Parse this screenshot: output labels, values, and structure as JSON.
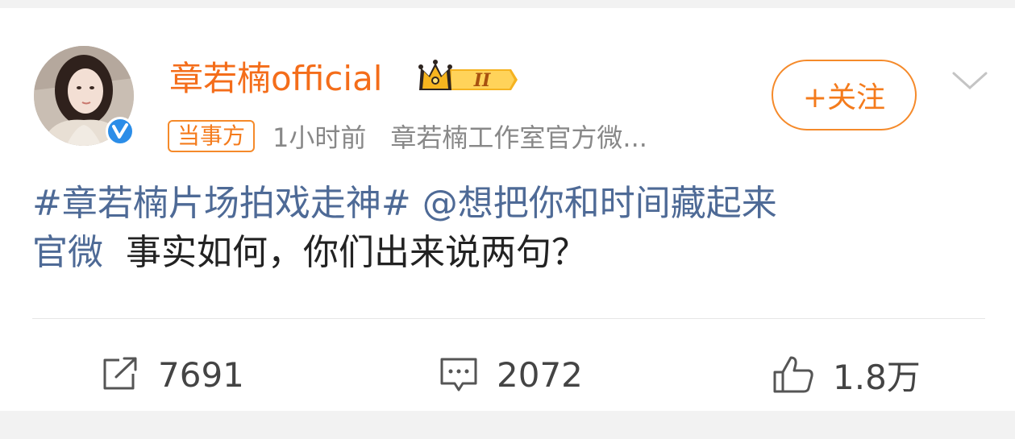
{
  "post": {
    "author": "章若楠official",
    "level_badge": "II",
    "tag": "当事方",
    "time": "1小时前",
    "source": "章若楠工作室官方微...",
    "follow_label": "+关注",
    "content": {
      "hashtag": "#章若楠片场拍戏走神#",
      "mention_line1": "@想把你和时间藏起来",
      "mention_line2": "官微",
      "text": "事实如何，你们出来说两句？"
    }
  },
  "actions": {
    "repost_count": "7691",
    "comment_count": "2072",
    "like_count": "1.8万"
  },
  "colors": {
    "accent": "#f47b1c",
    "link": "#4e6a96",
    "verify": "#2b8de8"
  },
  "icons": [
    "verified-icon",
    "crown-level-icon",
    "chevron-down-icon",
    "repost-icon",
    "comment-icon",
    "like-icon"
  ]
}
